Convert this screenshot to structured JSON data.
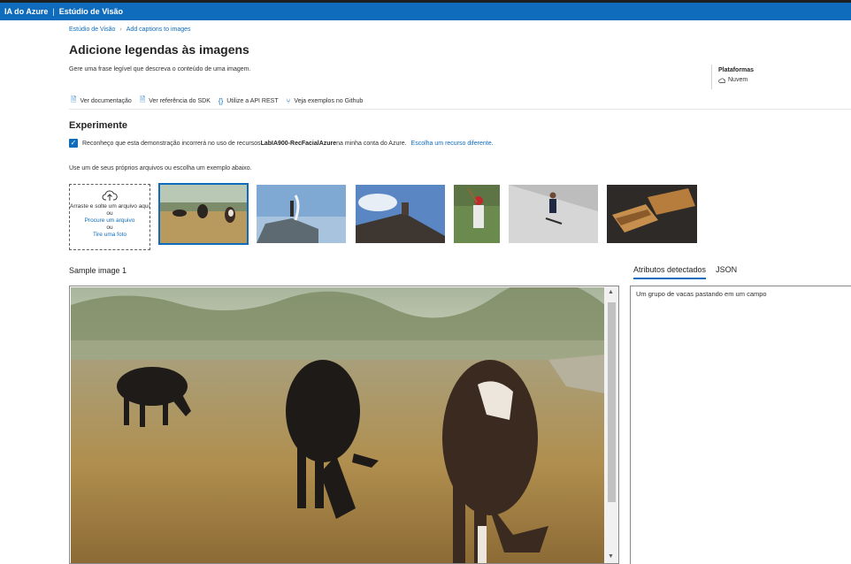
{
  "topbar": {
    "brand": "IA do Azure",
    "separator": "|",
    "product": "Estúdio de Visão"
  },
  "breadcrumb": {
    "home": "Estúdio de Visão",
    "current": "Add captions to images"
  },
  "page": {
    "title": "Adicione legendas às imagens",
    "description": "Gere uma frase legível que descreva o conteúdo de uma imagem."
  },
  "platforms": {
    "title": "Plataformas",
    "value": "Nuvem"
  },
  "links": [
    {
      "label": "Ver documentação",
      "icon": "document-icon"
    },
    {
      "label": "Ver referência do SDK",
      "icon": "document-icon"
    },
    {
      "label": "Utilize a API REST",
      "icon": "code-braces-icon"
    },
    {
      "label": "Veja exemplos no Github",
      "icon": "branch-icon"
    }
  ],
  "experiment": {
    "title": "Experimente",
    "consent_prefix": "Reconheço que esta demonstração incorrerá no uso de recursos",
    "resource_name": "LabIA900-RecFacialAzure",
    "consent_suffix": "na minha conta do Azure.",
    "choose_resource": "Escolha um recurso diferente.",
    "checked": true
  },
  "instruction": "Use um de seus próprios arquivos ou escolha um exemplo abaixo.",
  "upload": {
    "drag_text": "Arraste e solte um arquivo aqui",
    "or1": "ou",
    "browse": "Procure um arquivo",
    "or2": "ou",
    "photo": "Tire uma foto"
  },
  "sample_label": "Sample image 1",
  "results_tabs": {
    "detected": "Atributos detectados",
    "json": "JSON"
  },
  "caption": "Um grupo de vacas pastando em um campo",
  "colors": {
    "accent": "#0f6cbd",
    "topbar": "#0f6cbd"
  }
}
